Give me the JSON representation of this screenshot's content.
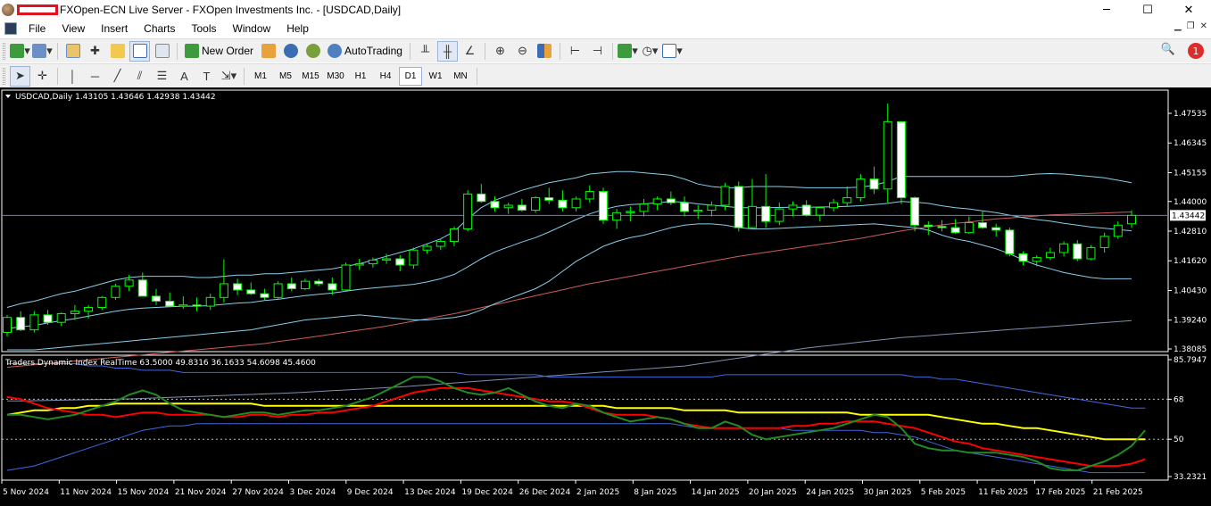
{
  "window": {
    "title": "FXOpen-ECN Live Server - FXOpen Investments Inc. - [USDCAD,Daily]",
    "minimize": "─",
    "maximize": "☐",
    "close": "✕"
  },
  "menu": [
    "File",
    "View",
    "Insert",
    "Charts",
    "Tools",
    "Window",
    "Help"
  ],
  "toolbar": {
    "new_order": "New Order",
    "autotrading": "AutoTrading"
  },
  "notifications": {
    "count": "1"
  },
  "timeframes": [
    {
      "label": "M1",
      "active": false
    },
    {
      "label": "M5",
      "active": false
    },
    {
      "label": "M15",
      "active": false
    },
    {
      "label": "M30",
      "active": false
    },
    {
      "label": "H1",
      "active": false
    },
    {
      "label": "H4",
      "active": false
    },
    {
      "label": "D1",
      "active": true
    },
    {
      "label": "W1",
      "active": false
    },
    {
      "label": "MN",
      "active": false
    }
  ],
  "chart_header": "USDCAD,Daily  1.43105 1.43646 1.42938 1.43442",
  "indicator_header": "Traders Dynamic Index RealTime 63.5000 49.8316 36.1633 54.6098 45.4600",
  "colors": {
    "background": "#000000",
    "candle_border": "#00ff00",
    "bull_body": "#000000",
    "bear_body": "#ffffff",
    "bb": "#87ceeb",
    "ma": "#cd5c5c",
    "price_line": "#6a7fc4",
    "tdi_green": "#228b22",
    "tdi_red": "#ff0000",
    "tdi_yellow": "#ffff00",
    "tdi_band": "#4169e1"
  },
  "chart_data": {
    "type": "candlestick",
    "symbol": "USDCAD",
    "timeframe": "Daily",
    "ylim": [
      1.38085,
      1.4793
    ],
    "current_price": "1.43442",
    "y_ticks": [
      "1.47535",
      "1.46345",
      "1.45155",
      "1.44000",
      "1.42810",
      "1.41620",
      "1.40430",
      "1.39240",
      "1.38085"
    ],
    "x_ticks": [
      "5 Nov 2024",
      "11 Nov 2024",
      "15 Nov 2024",
      "21 Nov 2024",
      "27 Nov 2024",
      "3 Dec 2024",
      "9 Dec 2024",
      "13 Dec 2024",
      "19 Dec 2024",
      "26 Dec 2024",
      "2 Jan 2025",
      "8 Jan 2025",
      "14 Jan 2025",
      "20 Jan 2025",
      "24 Jan 2025",
      "30 Jan 2025",
      "5 Feb 2025",
      "11 Feb 2025",
      "17 Feb 2025",
      "21 Feb 2025"
    ],
    "candles": [
      [
        1.3875,
        1.3945,
        1.3858,
        1.3935
      ],
      [
        1.3935,
        1.396,
        1.388,
        1.3885
      ],
      [
        1.3885,
        1.396,
        1.3875,
        1.3945
      ],
      [
        1.3945,
        1.3965,
        1.3905,
        1.3915
      ],
      [
        1.3915,
        1.3955,
        1.39,
        1.395
      ],
      [
        1.395,
        1.3985,
        1.3925,
        1.396
      ],
      [
        1.396,
        1.3985,
        1.393,
        1.3975
      ],
      [
        1.3975,
        1.402,
        1.3965,
        1.4015
      ],
      [
        1.4015,
        1.407,
        1.4005,
        1.406
      ],
      [
        1.406,
        1.4105,
        1.404,
        1.4085
      ],
      [
        1.4085,
        1.4115,
        1.403,
        1.402
      ],
      [
        1.402,
        1.405,
        1.3985,
        1.4
      ],
      [
        1.4,
        1.4035,
        1.398,
        1.398
      ],
      [
        1.398,
        1.402,
        1.397,
        1.3985
      ],
      [
        1.3985,
        1.4015,
        1.396,
        1.398
      ],
      [
        1.398,
        1.403,
        1.3965,
        1.4015
      ],
      [
        1.4015,
        1.4168,
        1.3995,
        1.407
      ],
      [
        1.407,
        1.409,
        1.4025,
        1.4045
      ],
      [
        1.4045,
        1.4075,
        1.4025,
        1.403
      ],
      [
        1.403,
        1.405,
        1.4005,
        1.4015
      ],
      [
        1.4015,
        1.408,
        1.4005,
        1.407
      ],
      [
        1.407,
        1.4095,
        1.404,
        1.405
      ],
      [
        1.405,
        1.409,
        1.4045,
        1.408
      ],
      [
        1.408,
        1.409,
        1.406,
        1.407
      ],
      [
        1.407,
        1.4095,
        1.4025,
        1.4045
      ],
      [
        1.4045,
        1.4155,
        1.404,
        1.4145
      ],
      [
        1.4145,
        1.417,
        1.4125,
        1.415
      ],
      [
        1.415,
        1.4175,
        1.4135,
        1.4165
      ],
      [
        1.4165,
        1.419,
        1.415,
        1.417
      ],
      [
        1.417,
        1.4185,
        1.412,
        1.4145
      ],
      [
        1.4145,
        1.4215,
        1.413,
        1.4205
      ],
      [
        1.4205,
        1.423,
        1.419,
        1.422
      ],
      [
        1.422,
        1.425,
        1.4205,
        1.424
      ],
      [
        1.424,
        1.43,
        1.422,
        1.429
      ],
      [
        1.429,
        1.4445,
        1.428,
        1.443
      ],
      [
        1.443,
        1.447,
        1.4395,
        1.44
      ],
      [
        1.44,
        1.442,
        1.436,
        1.4375
      ],
      [
        1.4375,
        1.4395,
        1.435,
        1.4385
      ],
      [
        1.4385,
        1.441,
        1.436,
        1.4365
      ],
      [
        1.4365,
        1.442,
        1.4355,
        1.4415
      ],
      [
        1.4415,
        1.4455,
        1.439,
        1.4405
      ],
      [
        1.4405,
        1.4445,
        1.436,
        1.4375
      ],
      [
        1.4375,
        1.442,
        1.436,
        1.441
      ],
      [
        1.441,
        1.4465,
        1.4395,
        1.444
      ],
      [
        1.444,
        1.4455,
        1.431,
        1.4325
      ],
      [
        1.4325,
        1.437,
        1.429,
        1.4355
      ],
      [
        1.4355,
        1.438,
        1.432,
        1.436
      ],
      [
        1.436,
        1.441,
        1.434,
        1.439
      ],
      [
        1.439,
        1.442,
        1.4365,
        1.441
      ],
      [
        1.441,
        1.444,
        1.4385,
        1.4395
      ],
      [
        1.4395,
        1.442,
        1.434,
        1.436
      ],
      [
        1.436,
        1.4385,
        1.433,
        1.4365
      ],
      [
        1.4365,
        1.44,
        1.434,
        1.4385
      ],
      [
        1.4385,
        1.4475,
        1.4365,
        1.446
      ],
      [
        1.446,
        1.448,
        1.428,
        1.4295
      ],
      [
        1.4295,
        1.449,
        1.429,
        1.438
      ],
      [
        1.438,
        1.451,
        1.4295,
        1.432
      ],
      [
        1.432,
        1.4395,
        1.4305,
        1.437
      ],
      [
        1.437,
        1.44,
        1.434,
        1.4385
      ],
      [
        1.4385,
        1.4405,
        1.434,
        1.4345
      ],
      [
        1.4345,
        1.438,
        1.432,
        1.4375
      ],
      [
        1.4375,
        1.441,
        1.436,
        1.4395
      ],
      [
        1.4395,
        1.446,
        1.438,
        1.4415
      ],
      [
        1.4415,
        1.451,
        1.44,
        1.449
      ],
      [
        1.449,
        1.454,
        1.443,
        1.445
      ],
      [
        1.445,
        1.4793,
        1.4395,
        1.472
      ],
      [
        1.472,
        1.451,
        1.439,
        1.4415
      ],
      [
        1.4415,
        1.442,
        1.428,
        1.4305
      ],
      [
        1.4305,
        1.432,
        1.4265,
        1.43
      ],
      [
        1.43,
        1.4325,
        1.428,
        1.4295
      ],
      [
        1.4295,
        1.433,
        1.427,
        1.4275
      ],
      [
        1.4275,
        1.434,
        1.427,
        1.4315
      ],
      [
        1.4315,
        1.436,
        1.429,
        1.4295
      ],
      [
        1.4295,
        1.431,
        1.426,
        1.4285
      ],
      [
        1.4285,
        1.4295,
        1.418,
        1.419
      ],
      [
        1.419,
        1.42,
        1.4145,
        1.416
      ],
      [
        1.416,
        1.4185,
        1.414,
        1.4175
      ],
      [
        1.4175,
        1.4215,
        1.4165,
        1.4195
      ],
      [
        1.4195,
        1.424,
        1.418,
        1.423
      ],
      [
        1.423,
        1.4245,
        1.416,
        1.417
      ],
      [
        1.417,
        1.4225,
        1.4165,
        1.4215
      ],
      [
        1.4215,
        1.4275,
        1.4195,
        1.426
      ],
      [
        1.426,
        1.432,
        1.425,
        1.4305
      ],
      [
        1.43105,
        1.43646,
        1.42938,
        1.43442
      ]
    ],
    "bb_upper": [
      1.3975,
      1.399,
      1.4,
      1.4015,
      1.403,
      1.404,
      1.4055,
      1.407,
      1.4085,
      1.4095,
      1.41,
      1.41,
      1.41,
      1.41,
      1.4095,
      1.4095,
      1.41,
      1.4105,
      1.4105,
      1.411,
      1.411,
      1.4115,
      1.412,
      1.4125,
      1.413,
      1.414,
      1.415,
      1.4165,
      1.418,
      1.4195,
      1.421,
      1.423,
      1.425,
      1.428,
      1.433,
      1.4375,
      1.4405,
      1.4425,
      1.4445,
      1.446,
      1.4475,
      1.4485,
      1.4495,
      1.451,
      1.4515,
      1.452,
      1.452,
      1.4515,
      1.451,
      1.4505,
      1.449,
      1.447,
      1.446,
      1.4455,
      1.4455,
      1.446,
      1.446,
      1.446,
      1.4458,
      1.4455,
      1.4455,
      1.4455,
      1.4455,
      1.4458,
      1.4465,
      1.448,
      1.45,
      1.45,
      1.45,
      1.45,
      1.45,
      1.45,
      1.45,
      1.45,
      1.45,
      1.4505,
      1.451,
      1.4512,
      1.451,
      1.4505,
      1.45,
      1.4495,
      1.4485,
      1.4475
    ],
    "bb_lower": [
      1.3805,
      1.3805,
      1.3805,
      1.381,
      1.3815,
      1.382,
      1.3825,
      1.383,
      1.3835,
      1.384,
      1.3845,
      1.385,
      1.3855,
      1.386,
      1.3865,
      1.387,
      1.3875,
      1.388,
      1.3885,
      1.3895,
      1.3905,
      1.3915,
      1.3925,
      1.393,
      1.3935,
      1.394,
      1.3945,
      1.394,
      1.3935,
      1.393,
      1.3925,
      1.3925,
      1.393,
      1.3935,
      1.3945,
      1.3965,
      1.399,
      1.401,
      1.403,
      1.405,
      1.408,
      1.412,
      1.416,
      1.419,
      1.422,
      1.424,
      1.4255,
      1.4265,
      1.428,
      1.4295,
      1.4305,
      1.431,
      1.431,
      1.4305,
      1.4295,
      1.429,
      1.429,
      1.4292,
      1.4295,
      1.4298,
      1.43,
      1.4302,
      1.4305,
      1.4308,
      1.431,
      1.4305,
      1.43,
      1.4295,
      1.4285,
      1.4265,
      1.425,
      1.424,
      1.4225,
      1.421,
      1.419,
      1.4165,
      1.4145,
      1.413,
      1.4115,
      1.4105,
      1.4095,
      1.409,
      1.409,
      1.409
    ],
    "ma": [
      1.3735,
      1.374,
      1.3745,
      1.375,
      1.3755,
      1.376,
      1.3765,
      1.377,
      1.3775,
      1.378,
      1.3785,
      1.379,
      1.3795,
      1.38,
      1.3805,
      1.381,
      1.3815,
      1.382,
      1.3825,
      1.383,
      1.3838,
      1.3845,
      1.3852,
      1.386,
      1.3868,
      1.3876,
      1.3884,
      1.3892,
      1.39,
      1.391,
      1.392,
      1.393,
      1.394,
      1.395,
      1.3962,
      1.3974,
      1.3986,
      1.3998,
      1.401,
      1.4022,
      1.4034,
      1.4046,
      1.4058,
      1.407,
      1.408,
      1.409,
      1.41,
      1.411,
      1.412,
      1.413,
      1.414,
      1.415,
      1.416,
      1.417,
      1.418,
      1.4188,
      1.4196,
      1.4204,
      1.4212,
      1.422,
      1.4228,
      1.4236,
      1.4244,
      1.4252,
      1.4262,
      1.4272,
      1.4282,
      1.429,
      1.4298,
      1.4306,
      1.4312,
      1.4318,
      1.4324,
      1.433,
      1.4334,
      1.4338,
      1.4342,
      1.4346,
      1.4348,
      1.435,
      1.4352,
      1.4354,
      1.4356,
      1.4358
    ],
    "long_ma": [
      1.36,
      1.36,
      1.3601,
      1.3602,
      1.3603,
      1.3604,
      1.3605,
      1.3606,
      1.3607,
      1.3608,
      1.361,
      1.3612,
      1.3614,
      1.3616,
      1.3618,
      1.362,
      1.3622,
      1.3624,
      1.3626,
      1.3628,
      1.363,
      1.3632,
      1.3635,
      1.3638,
      1.3641,
      1.3644,
      1.3647,
      1.365,
      1.3653,
      1.3656,
      1.366,
      1.3664,
      1.3668,
      1.3672,
      1.3676,
      1.368,
      1.3684,
      1.3688,
      1.3692,
      1.3696,
      1.37,
      1.3704,
      1.3708,
      1.3712,
      1.3716,
      1.372,
      1.3724,
      1.3728,
      1.3732,
      1.3736,
      1.374,
      1.3748,
      1.3756,
      1.3764,
      1.3772,
      1.378,
      1.3788,
      1.3796,
      1.3804,
      1.3812,
      1.3818,
      1.3824,
      1.383,
      1.3836,
      1.3842,
      1.3848,
      1.3854,
      1.3858,
      1.3862,
      1.3866,
      1.387,
      1.3874,
      1.3878,
      1.3882,
      1.3886,
      1.389,
      1.3894,
      1.3898,
      1.3902,
      1.3906,
      1.391,
      1.3914,
      1.3918,
      1.3922
    ],
    "tdi": {
      "ylim": [
        33.2321,
        85.7947
      ],
      "y_ticks": [
        "85.7947",
        "68",
        "50",
        "33.2321"
      ],
      "levels": [
        68,
        50
      ],
      "upper_band": [
        84,
        84,
        84,
        84,
        84,
        84,
        83,
        83,
        82,
        82,
        81,
        81,
        81,
        80,
        80,
        80,
        80,
        80,
        80,
        80,
        80,
        80,
        80,
        80,
        80,
        80,
        80,
        80,
        80,
        80,
        80,
        80,
        80,
        80,
        79,
        79,
        79,
        79,
        79,
        79,
        78,
        78,
        78,
        78,
        78,
        78,
        78,
        78,
        78,
        78,
        78,
        78,
        78,
        79,
        79,
        79,
        79,
        79,
        79,
        79,
        79,
        79,
        79,
        79,
        79,
        79,
        79,
        78,
        78,
        77,
        77,
        76,
        75,
        74,
        73,
        72,
        71,
        70,
        69,
        68,
        67,
        66,
        65,
        64,
        64
      ],
      "lower_band": [
        36,
        37,
        38,
        40,
        42,
        44,
        46,
        48,
        50,
        52,
        54,
        55,
        56,
        56,
        57,
        57,
        57,
        57,
        57,
        57,
        57,
        57,
        57,
        57,
        57,
        57,
        57,
        57,
        57,
        57,
        57,
        57,
        57,
        57,
        57,
        57,
        57,
        57,
        57,
        57,
        57,
        57,
        57,
        57,
        57,
        57,
        57,
        57,
        57,
        57,
        56,
        55,
        55,
        55,
        55,
        55,
        55,
        55,
        54,
        54,
        54,
        54,
        54,
        54,
        53,
        53,
        52,
        51,
        49,
        47,
        45,
        44,
        43,
        42,
        41,
        40,
        39,
        38,
        37,
        36,
        35,
        35,
        35,
        35,
        35
      ],
      "yellow": [
        61,
        62,
        63,
        63,
        64,
        64,
        65,
        65,
        66,
        66,
        66,
        66,
        66,
        66,
        66,
        66,
        66,
        66,
        66,
        65,
        65,
        65,
        65,
        65,
        65,
        65,
        65,
        65,
        65,
        65,
        65,
        65,
        65,
        65,
        65,
        65,
        65,
        65,
        65,
        65,
        65,
        65,
        65,
        65,
        65,
        64,
        64,
        64,
        64,
        64,
        63,
        63,
        63,
        63,
        62,
        62,
        62,
        62,
        62,
        62,
        62,
        62,
        62,
        61,
        61,
        61,
        61,
        61,
        61,
        60,
        59,
        58,
        57,
        57,
        56,
        55,
        55,
        54,
        53,
        52,
        51,
        50,
        50,
        50,
        50
      ],
      "red": [
        69,
        68,
        66,
        64,
        63,
        62,
        61,
        61,
        60,
        61,
        62,
        62,
        61,
        61,
        61,
        61,
        60,
        60,
        61,
        61,
        60,
        61,
        61,
        62,
        62,
        63,
        64,
        65,
        67,
        69,
        71,
        72,
        73,
        73,
        73,
        72,
        71,
        70,
        69,
        68,
        67,
        67,
        66,
        64,
        62,
        61,
        61,
        61,
        60,
        59,
        57,
        56,
        55,
        55,
        55,
        55,
        55,
        55,
        56,
        56,
        57,
        57,
        58,
        58,
        58,
        57,
        56,
        55,
        53,
        51,
        49,
        48,
        46,
        45,
        44,
        43,
        42,
        41,
        40,
        39,
        38,
        38,
        38,
        39,
        41
      ],
      "green": [
        61,
        61,
        60,
        59,
        60,
        61,
        63,
        65,
        67,
        70,
        72,
        70,
        66,
        63,
        62,
        61,
        60,
        61,
        62,
        62,
        61,
        62,
        63,
        63,
        64,
        65,
        67,
        69,
        72,
        75,
        78,
        78,
        76,
        73,
        71,
        70,
        71,
        73,
        70,
        67,
        65,
        64,
        66,
        65,
        62,
        60,
        58,
        59,
        60,
        59,
        57,
        55,
        55,
        58,
        56,
        52,
        50,
        51,
        52,
        53,
        54,
        55,
        57,
        59,
        61,
        60,
        55,
        48,
        46,
        45,
        45,
        44,
        44,
        44,
        43,
        42,
        40,
        37,
        36,
        36,
        38,
        40,
        43,
        47,
        54
      ]
    }
  }
}
